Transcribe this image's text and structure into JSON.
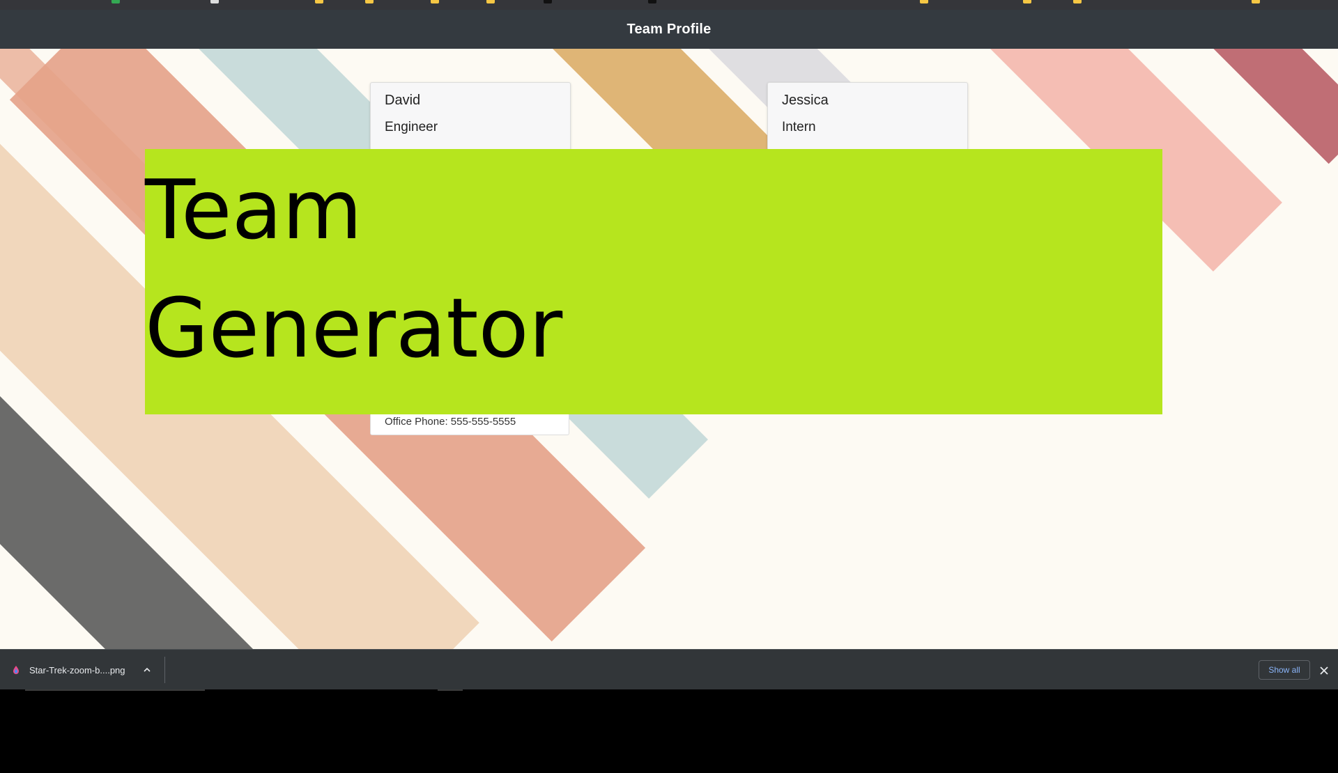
{
  "header": {
    "title": "Team Profile"
  },
  "cards": [
    {
      "name": "David",
      "role": "Engineer",
      "footer": "Office Phone: 555-555-5555"
    },
    {
      "name": "Jessica",
      "role": "Intern"
    }
  ],
  "banner": {
    "line1": "Team",
    "line2": "Generator",
    "color": "#b6e51e"
  },
  "download_bar": {
    "file_name": "Star-Trek-zoom-b....png",
    "show_all_label": "Show all",
    "icons": {
      "file": "file-icon",
      "expand": "chevron-up-icon",
      "close": "close-icon"
    }
  },
  "colors": {
    "header_bg": "#343a40",
    "download_bar_bg": "#323639",
    "link_blue": "#8ab4f8"
  }
}
